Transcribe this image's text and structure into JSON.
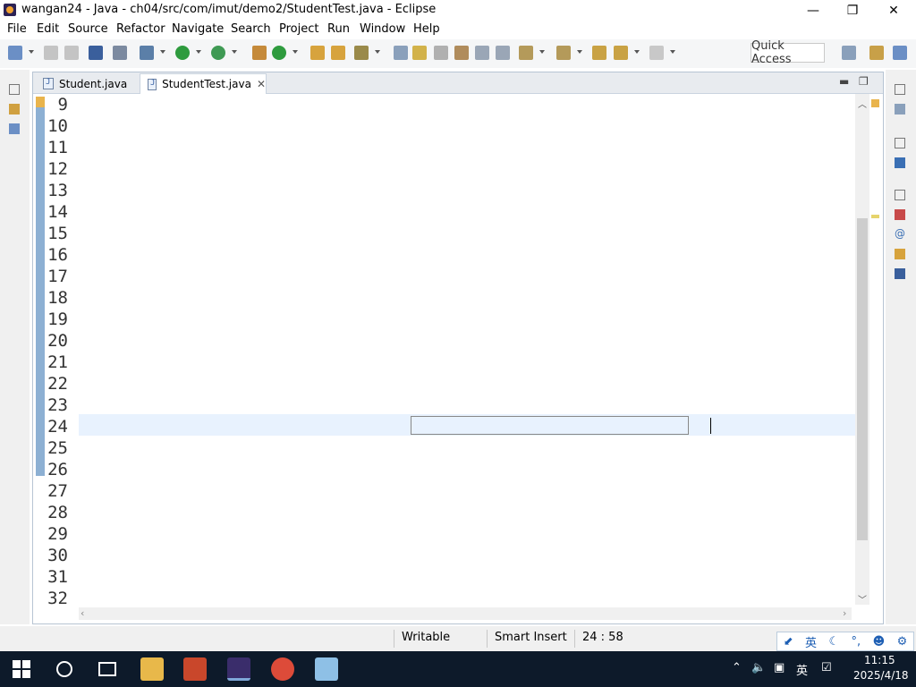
{
  "window": {
    "title": "wangan24 - Java - ch04/src/com/imut/demo2/StudentTest.java - Eclipse",
    "minimize": "—",
    "maximize": "❐",
    "close": "✕"
  },
  "menu": [
    "File",
    "Edit",
    "Source",
    "Refactor",
    "Navigate",
    "Search",
    "Project",
    "Run",
    "Window",
    "Help"
  ],
  "toolbar": {
    "quick_access": "Quick Access"
  },
  "tabs": [
    {
      "label": "Student.java",
      "active": false
    },
    {
      "label": "StudentTest.java",
      "active": true
    }
  ],
  "editor": {
    "line_numbers": [
      "9",
      "10",
      "11",
      "12",
      "13",
      "14",
      "15",
      "16",
      "17",
      "18",
      "19",
      "20",
      "21",
      "22",
      "23",
      "24",
      "25",
      "26",
      "27",
      "28",
      "29",
      "30",
      "31",
      "32"
    ],
    "current_line": "24"
  },
  "status": {
    "writable": "Writable",
    "insert_mode": "Smart Insert",
    "position": "24 : 58"
  },
  "ime": {
    "lang": "英"
  },
  "taskbar": {
    "time": "11:15",
    "date": "2025/4/18",
    "lang": "英"
  },
  "colors": {
    "keyword": "#7f0055",
    "comment": "#3f7f5f",
    "string": "#2a00ff",
    "field": "#0000c0",
    "current_line": "#e8f2fe",
    "taskbar": "#0d1a2a"
  }
}
